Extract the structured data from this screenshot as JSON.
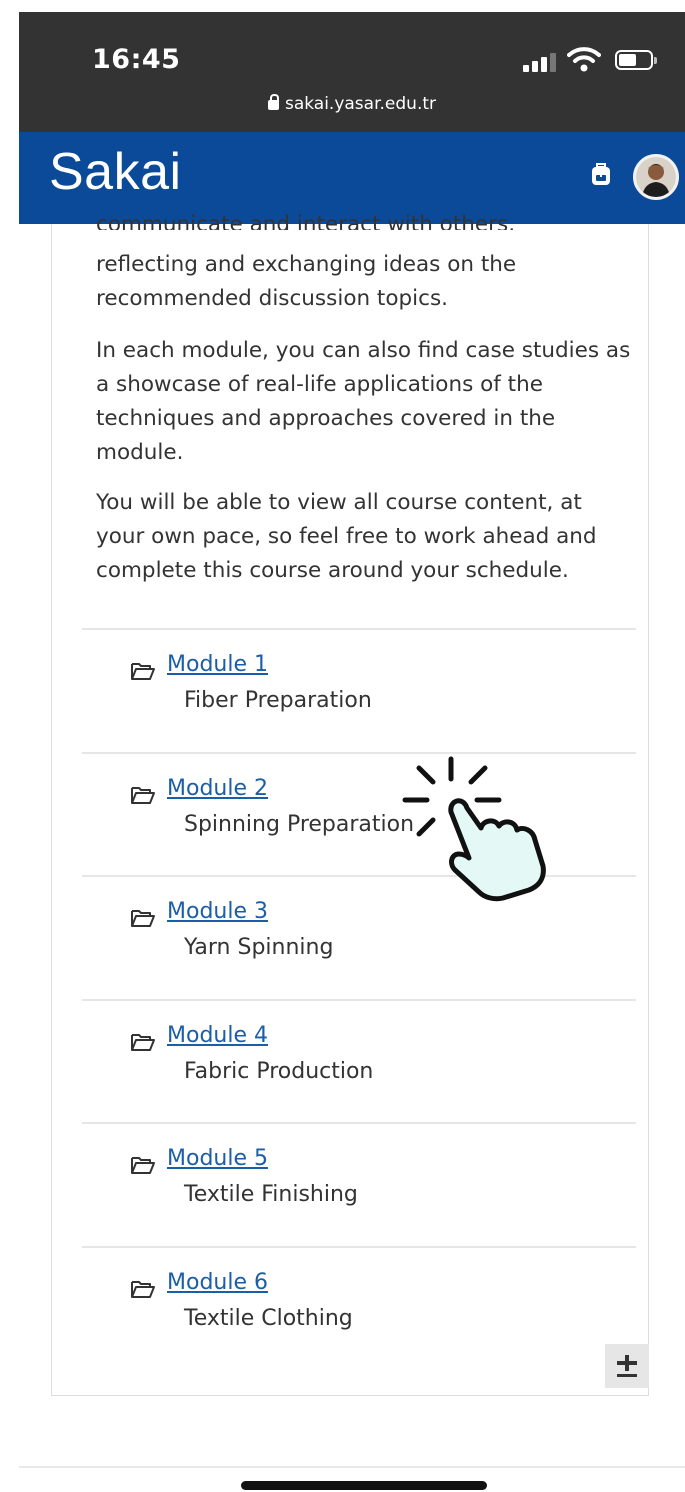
{
  "status_bar": {
    "time": "16:45",
    "url": "sakai.yasar.edu.tr"
  },
  "header": {
    "logo": "Sakai"
  },
  "intro": {
    "cut_line": "communicate and interact with others,",
    "p1": "reflecting and exchanging ideas on the recommended discussion topics.",
    "p2": "In each module, you can also find case studies as a showcase of real-life applications of the techniques and approaches covered in the module.",
    "p3": "You will be able to view all course content, at your own pace, so feel free to work ahead and complete this course around your schedule."
  },
  "modules": [
    {
      "link": "Module 1",
      "title": "Fiber Preparation"
    },
    {
      "link": "Module 2",
      "title": "Spinning Preparation"
    },
    {
      "link": "Module 3",
      "title": "Yarn Spinning"
    },
    {
      "link": "Module 4",
      "title": "Fabric Production"
    },
    {
      "link": "Module 5",
      "title": "Textile Finishing"
    },
    {
      "link": "Module 6",
      "title": "Textile Clothing"
    }
  ],
  "expand_button": "+",
  "colors": {
    "header": "#0b4a99",
    "status_bar": "#333333",
    "link": "#1b5ea8",
    "hand_fill": "#e4f8f5"
  },
  "icons": [
    "lock-icon",
    "signal-icon",
    "wifi-icon",
    "battery-icon",
    "backpack-icon",
    "avatar",
    "folder-icon",
    "tap-hand-icon"
  ]
}
